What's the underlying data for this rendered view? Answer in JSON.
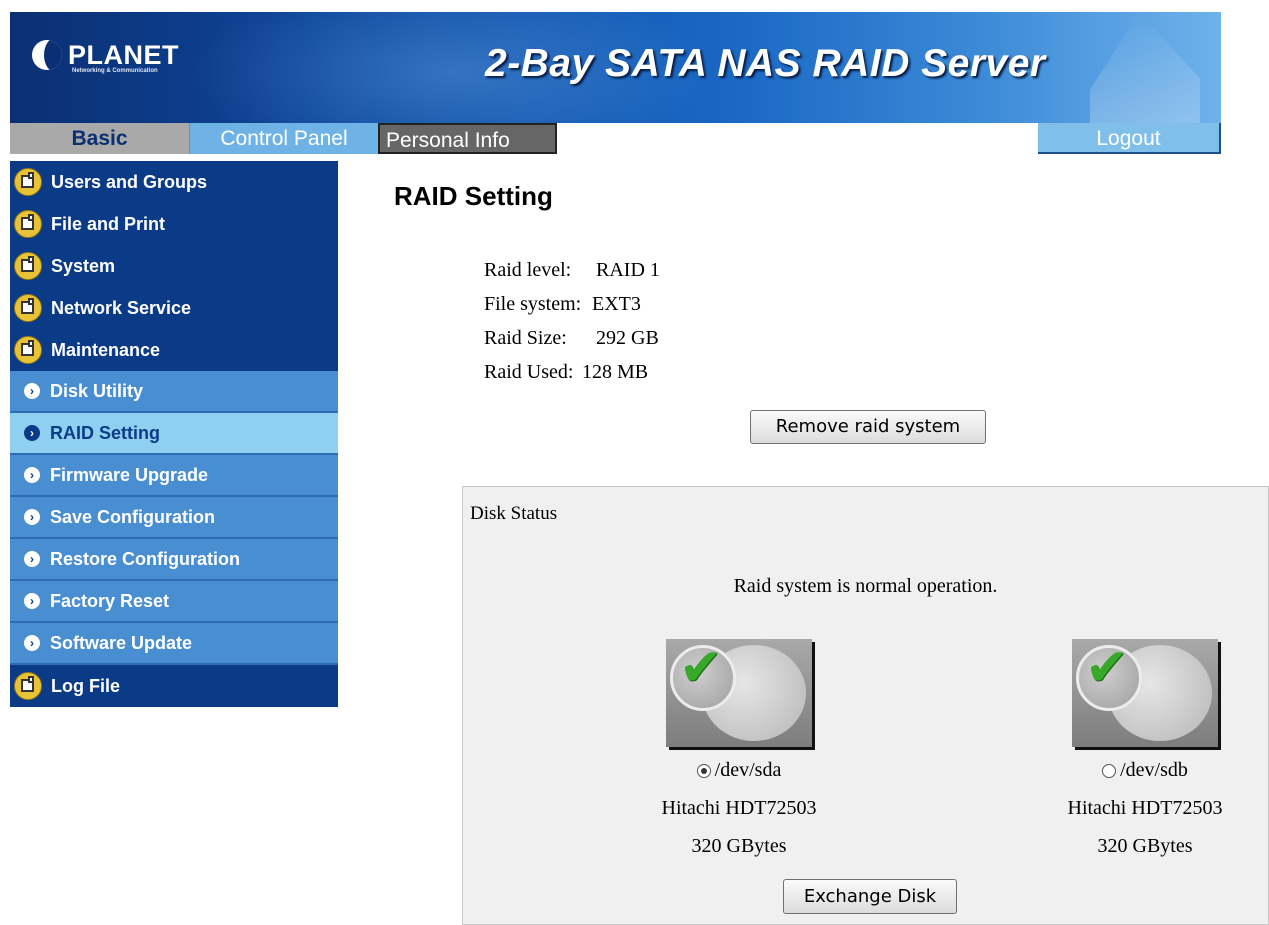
{
  "banner": {
    "logo_name": "PLANET",
    "logo_tagline": "Networking & Communication",
    "title": "2-Bay SATA NAS RAID Server"
  },
  "topnav": {
    "basic": "Basic",
    "control_panel": "Control Panel",
    "personal_info": "Personal Info",
    "logout": "Logout"
  },
  "sidebar": {
    "items": [
      {
        "label": "Users and Groups",
        "type": "main"
      },
      {
        "label": "File and Print",
        "type": "main"
      },
      {
        "label": "System",
        "type": "main"
      },
      {
        "label": "Network Service",
        "type": "main"
      },
      {
        "label": "Maintenance",
        "type": "main"
      },
      {
        "label": "Disk Utility",
        "type": "sub"
      },
      {
        "label": "RAID Setting",
        "type": "sub",
        "active": true
      },
      {
        "label": "Firmware Upgrade",
        "type": "sub"
      },
      {
        "label": "Save Configuration",
        "type": "sub"
      },
      {
        "label": "Restore Configuration",
        "type": "sub"
      },
      {
        "label": "Factory Reset",
        "type": "sub"
      },
      {
        "label": "Software Update",
        "type": "sub"
      },
      {
        "label": "Log File",
        "type": "main"
      }
    ]
  },
  "main": {
    "title": "RAID Setting",
    "raid_level_label": "Raid level:",
    "raid_level_value": "RAID 1",
    "file_system_label": "File system:",
    "file_system_value": "EXT3",
    "raid_size_label": "Raid Size:",
    "raid_size_value": "292 GB",
    "raid_used_label": "Raid Used:",
    "raid_used_value": "128 MB",
    "remove_button": "Remove raid system"
  },
  "disk_status": {
    "label": "Disk Status",
    "message": "Raid system is normal operation.",
    "disks": [
      {
        "device": "/dev/sda",
        "model": "Hitachi HDT72503",
        "size": "320 GBytes",
        "selected": true
      },
      {
        "device": "/dev/sdb",
        "model": "Hitachi HDT72503",
        "size": "320 GBytes",
        "selected": false
      }
    ],
    "exchange_button": "Exchange Disk"
  },
  "colors": {
    "banner_dark": "#0b2f73",
    "sidebar_main": "#0b3b87",
    "sidebar_sub": "#4a8ed2",
    "sidebar_active": "#8fd0f0",
    "panel_bg": "#f0f0f0"
  }
}
